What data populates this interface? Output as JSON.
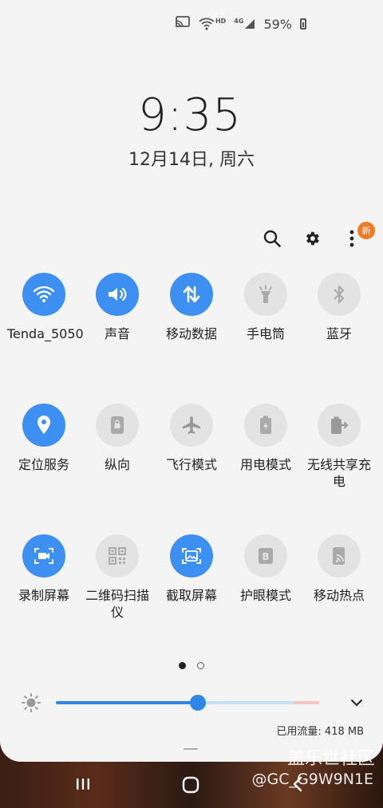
{
  "status_bar": {
    "battery_percent": "59%",
    "icons": [
      "screencast-icon",
      "wifi-hd-icon",
      "4g-signal-icon",
      "battery-icon"
    ],
    "hd_label": "HD",
    "network_label": "4G"
  },
  "clock": {
    "time": "9:35",
    "date": "12月14日, 周六"
  },
  "top_actions": {
    "icons": [
      "search-icon",
      "settings-gear-icon",
      "more-options-icon"
    ],
    "new_badge": "新"
  },
  "tiles": [
    {
      "label": "Tenda_5050",
      "icon": "wifi-icon",
      "on": true
    },
    {
      "label": "声音",
      "icon": "volume-icon",
      "on": true
    },
    {
      "label": "移动数据",
      "icon": "mobile-data-icon",
      "on": true
    },
    {
      "label": "手电筒",
      "icon": "flashlight-icon",
      "on": false
    },
    {
      "label": "蓝牙",
      "icon": "bluetooth-icon",
      "on": false
    },
    {
      "label": "定位服务",
      "icon": "location-icon",
      "on": true
    },
    {
      "label": "纵向",
      "icon": "portrait-lock-icon",
      "on": false
    },
    {
      "label": "飞行模式",
      "icon": "airplane-icon",
      "on": false
    },
    {
      "label": "用电模式",
      "icon": "power-mode-icon",
      "on": false
    },
    {
      "label": "无线共享充电",
      "icon": "wireless-powershare-icon",
      "on": false
    },
    {
      "label": "录制屏幕",
      "icon": "screen-record-icon",
      "on": true
    },
    {
      "label": "二维码扫描仪",
      "icon": "qr-scanner-icon",
      "on": false
    },
    {
      "label": "截取屏幕",
      "icon": "screenshot-icon",
      "on": true
    },
    {
      "label": "护眼模式",
      "icon": "eye-comfort-icon",
      "on": false
    },
    {
      "label": "移动热点",
      "icon": "hotspot-icon",
      "on": false
    }
  ],
  "pager": {
    "pages": 2,
    "current": 1
  },
  "brightness": {
    "level": 0.54,
    "icon": "brightness-icon",
    "expand_icon": "chevron-down-icon"
  },
  "data_usage": "已用流量: 418 MB",
  "navbar": {
    "icons": [
      "recent-apps-icon",
      "home-icon",
      "back-icon"
    ]
  },
  "watermark": {
    "site": "盖乐世社区",
    "user": "@GC_G9W9N1E"
  }
}
